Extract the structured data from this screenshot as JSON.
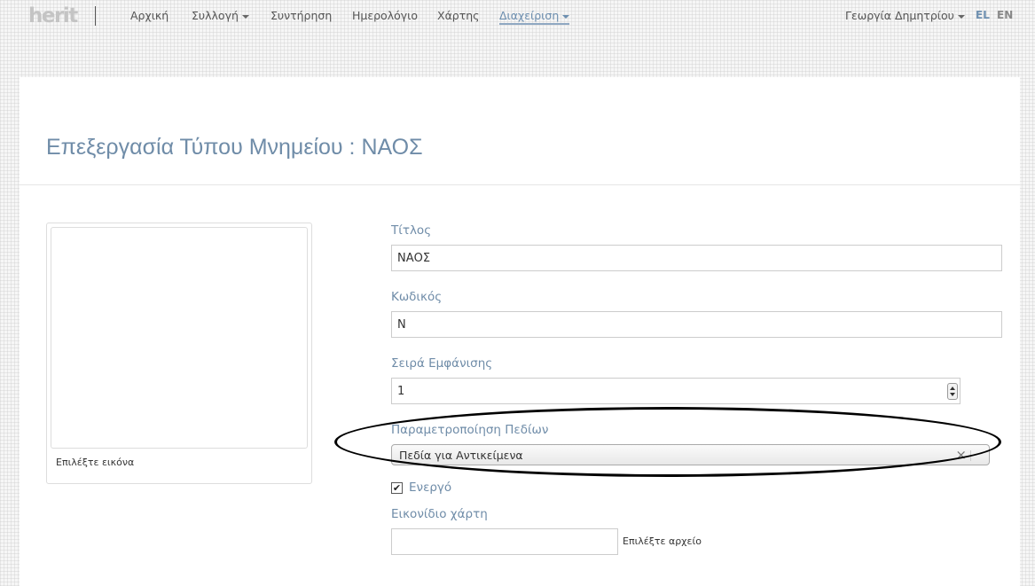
{
  "navbar": {
    "logo": "herit",
    "items": [
      "Αρχική",
      "Συλλογή",
      "Συντήρηση",
      "Ημερολόγιο",
      "Χάρτης",
      "Διαχείριση"
    ],
    "user": "Γεωργία Δημητρίου",
    "lang_el": "EL",
    "lang_en": "EN"
  },
  "page": {
    "title": "Επεξεργασία Τύπου Μνημείου : ΝΑΟΣ"
  },
  "image_card": {
    "caption": "Επιλέξτε εικόνα"
  },
  "form": {
    "title_label": "Τίτλος",
    "title_value": "ΝΑΟΣ",
    "code_label": "Κωδικός",
    "code_value": "Ν",
    "order_label": "Σειρά Εμφάνισης",
    "order_value": "1",
    "fields_label": "Παραμετροποίηση Πεδίων",
    "fields_value": "Πεδία για Αντικείμενα",
    "clear_symbol": "×",
    "check_mark": "✔",
    "active_label": "Ενεργό",
    "map_icon_label": "Εικονίδιο χάρτη",
    "file_button": "Επιλέξτε αρχείο"
  },
  "colors": {
    "accent": "#6f8ca8",
    "lang_active": "#6d8fb0",
    "lang_inactive": "#888888"
  }
}
